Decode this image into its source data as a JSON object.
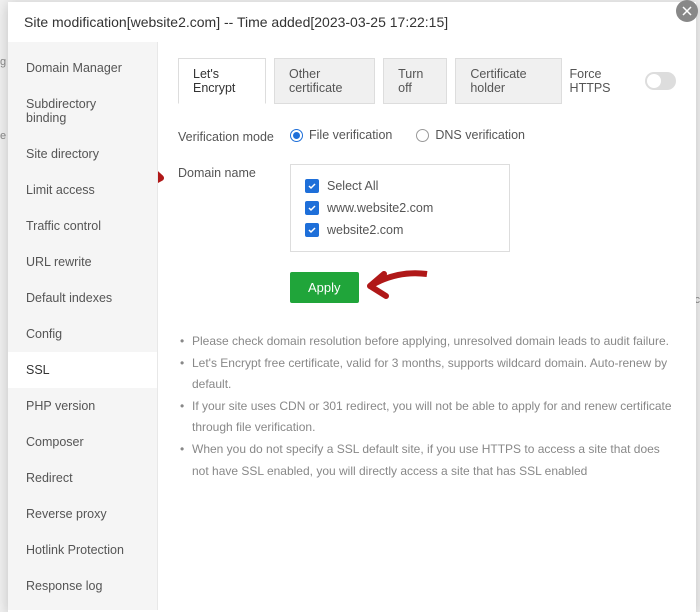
{
  "title": "Site modification[website2.com] -- Time added[2023-03-25 17:22:15]",
  "sidebar": {
    "items": [
      {
        "label": "Domain Manager"
      },
      {
        "label": "Subdirectory binding"
      },
      {
        "label": "Site directory"
      },
      {
        "label": "Limit access"
      },
      {
        "label": "Traffic control"
      },
      {
        "label": "URL rewrite"
      },
      {
        "label": "Default indexes"
      },
      {
        "label": "Config"
      },
      {
        "label": "SSL"
      },
      {
        "label": "PHP version"
      },
      {
        "label": "Composer"
      },
      {
        "label": "Redirect"
      },
      {
        "label": "Reverse proxy"
      },
      {
        "label": "Hotlink Protection"
      },
      {
        "label": "Response log"
      }
    ],
    "active_index": 8
  },
  "tabs": {
    "items": [
      {
        "label": "Let's Encrypt"
      },
      {
        "label": "Other certificate"
      },
      {
        "label": "Turn off"
      },
      {
        "label": "Certificate holder"
      }
    ],
    "active_index": 0
  },
  "force_https": {
    "label": "Force HTTPS",
    "enabled": false
  },
  "verification": {
    "label": "Verification mode",
    "options": [
      {
        "label": "File verification",
        "checked": true
      },
      {
        "label": "DNS verification",
        "checked": false
      }
    ]
  },
  "domain": {
    "label": "Domain name",
    "select_all": {
      "label": "Select All",
      "checked": true
    },
    "items": [
      {
        "label": "www.website2.com",
        "checked": true
      },
      {
        "label": "website2.com",
        "checked": true
      }
    ]
  },
  "apply_label": "Apply",
  "notes": [
    "Please check domain resolution before applying, unresolved domain leads to audit failure.",
    "Let's Encrypt free certificate, valid for 3 months, supports wildcard domain. Auto-renew by default.",
    "If your site uses CDN or 301 redirect, you will not be able to apply for and renew certificate through file verification.",
    "When you do not specify a SSL default site, if you use HTTPS to access a site that does not have SSL enabled, you will directly access a site that has SSL enabled"
  ],
  "bg_letters": {
    "g": "g",
    "e": "e",
    "t": "Tc"
  }
}
